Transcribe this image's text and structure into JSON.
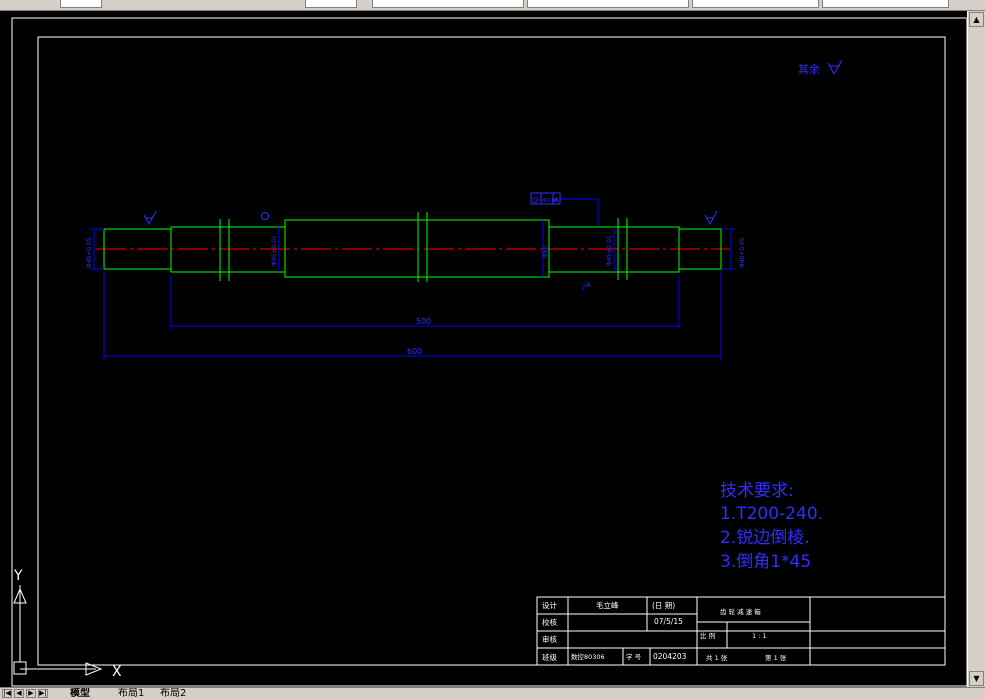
{
  "tabs": [
    "模型",
    "布局1",
    "布局2"
  ],
  "nav_buttons": [
    "|◀",
    "◀",
    "▶",
    "▶|"
  ],
  "drawing": {
    "roughness_note": "其余",
    "tolerance_frame": {
      "symbol": "◎",
      "value": "Φ0.05",
      "datum": "A"
    },
    "datum_label": "A",
    "dim_500": "500",
    "dim_600": "600",
    "diameter_labels": [
      "Φ40+0.05",
      "Φ45±0.01",
      "Φ50",
      "Φ45±0.01",
      "Φ40+0.05"
    ],
    "tech_requirements": {
      "title": "技术要求:",
      "items": [
        "1.T200-240.",
        "2.锐边倒棱.",
        "3.倒角1*45"
      ]
    },
    "title_block": {
      "design_label": "设计",
      "designer": "毛立峰",
      "date_label": "(日 期)",
      "check_label": "校核",
      "date": "07/5/15",
      "review_label": "审核",
      "class_label": "班级",
      "class_value": "数控80306",
      "student_no_label": "学 号",
      "student_no": "0204203",
      "part_name": "齿 轮 减 速 箱",
      "scale_label": "比 例",
      "scale_value": "1 : 1",
      "sheets_total": "共 1 张",
      "sheet_no": "第 1 张"
    },
    "ucs": {
      "x": "X",
      "y": "Y"
    }
  },
  "colors": {
    "background": "#000000",
    "frame": "#ffffff",
    "outline": "#00ff00",
    "dimension": "#0000ff",
    "centerline": "#ff0000",
    "text_blue": "#2f2fff"
  }
}
